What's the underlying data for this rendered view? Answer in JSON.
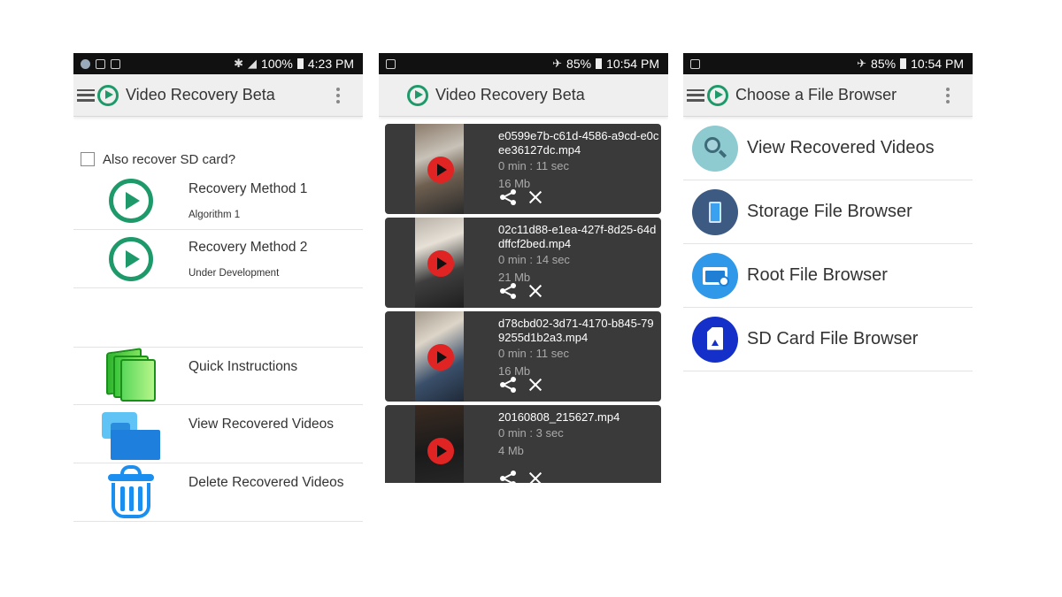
{
  "colors": {
    "brand_green": "#1e9a6a",
    "status_bar": "#111111",
    "app_bar": "#efefef",
    "card_dark": "#3a3a3a",
    "play_red": "#e02424"
  },
  "phone1": {
    "status": {
      "battery": "100%",
      "time": "4:23 PM"
    },
    "title": "Video Recovery Beta",
    "sd_label": "Also recover SD card?",
    "methods": [
      {
        "title": "Recovery Method 1",
        "subtitle": "Algorithm 1",
        "icon": "play-circle-icon"
      },
      {
        "title": "Recovery Method 2",
        "subtitle": "Under Development",
        "icon": "play-circle-icon"
      }
    ],
    "menu": [
      {
        "label": "Quick Instructions",
        "icon": "books-icon"
      },
      {
        "label": "View Recovered Videos",
        "icon": "folder-icon"
      },
      {
        "label": "Delete Recovered Videos",
        "icon": "trash-icon"
      }
    ]
  },
  "phone2": {
    "status": {
      "battery": "85%",
      "time": "10:54 PM"
    },
    "title": "Video Recovery Beta",
    "videos": [
      {
        "name": "e0599e7b-c61d-4586-a9cd-e0cee36127dc.mp4",
        "duration": "0 min : 11 sec",
        "size": "16 Mb"
      },
      {
        "name": "02c11d88-e1ea-427f-8d25-64ddffcf2bed.mp4",
        "duration": "0 min : 14 sec",
        "size": "21 Mb"
      },
      {
        "name": "d78cbd02-3d71-4170-b845-799255d1b2a3.mp4",
        "duration": "0 min : 11 sec",
        "size": "16 Mb"
      },
      {
        "name": "20160808_215627.mp4",
        "duration": "0 min : 3 sec",
        "size": "4 Mb"
      }
    ]
  },
  "phone3": {
    "status": {
      "battery": "85%",
      "time": "10:54 PM"
    },
    "title": "Choose a File Browser",
    "items": [
      {
        "label": "View Recovered Videos",
        "icon": "search-icon",
        "color": "#8ecbd1"
      },
      {
        "label": "Storage File Browser",
        "icon": "phone-icon",
        "color": "#3c5a82"
      },
      {
        "label": "Root File Browser",
        "icon": "root-folder-icon",
        "color": "#2f98e8"
      },
      {
        "label": "SD Card File Browser",
        "icon": "sd-card-icon",
        "color": "#1430c8"
      }
    ]
  }
}
